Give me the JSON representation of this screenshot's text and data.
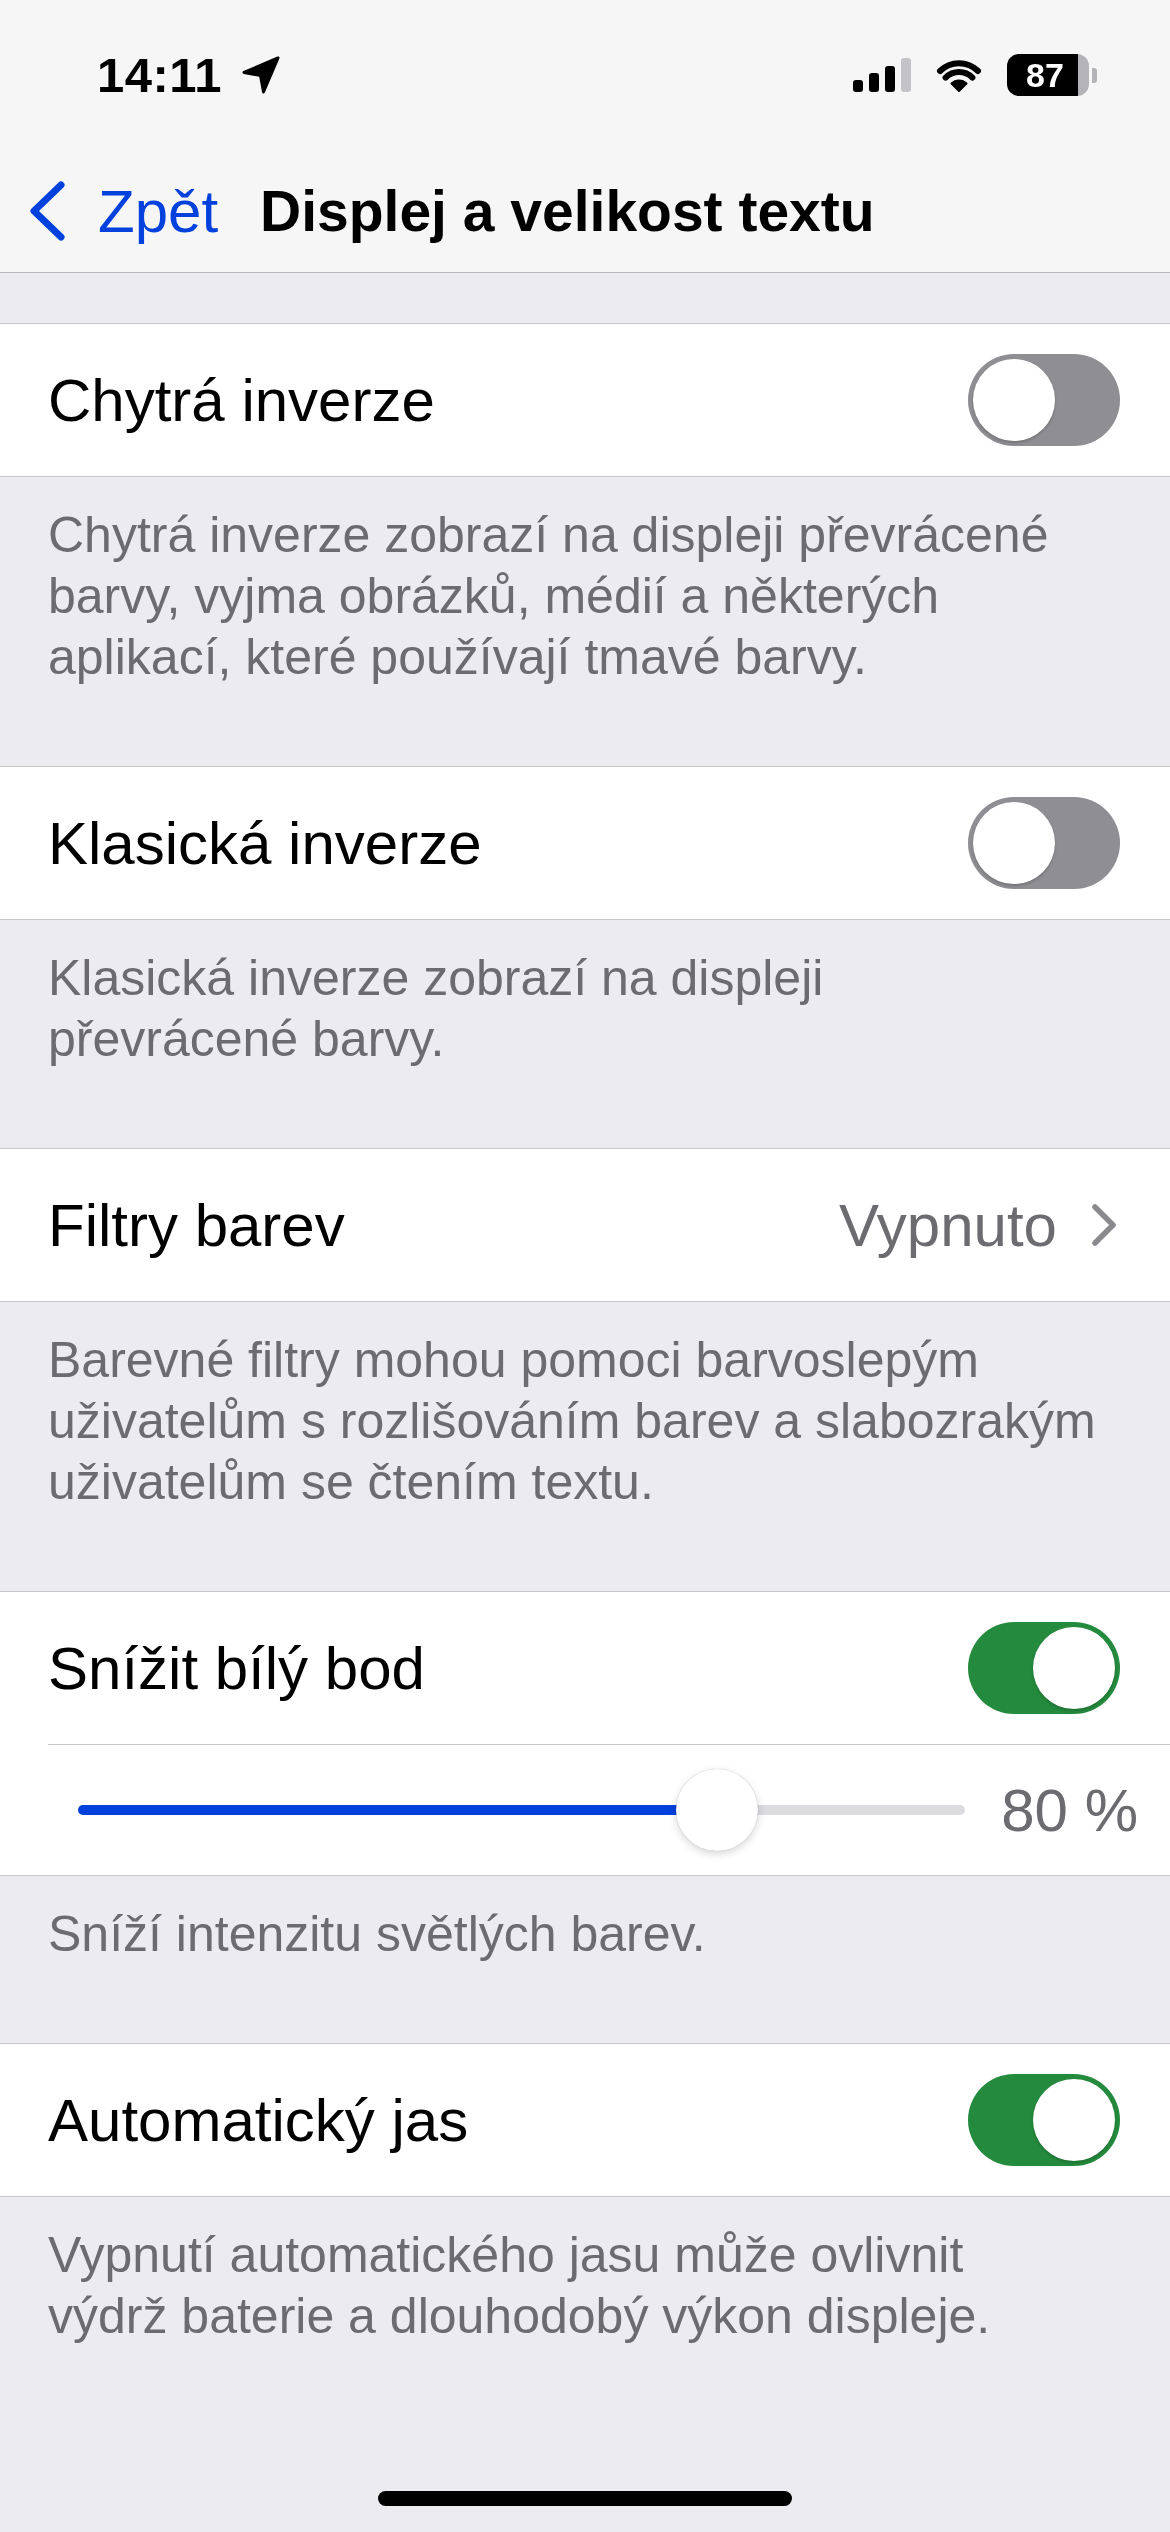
{
  "status_bar": {
    "time": "14:11",
    "battery": "87"
  },
  "nav": {
    "back": "Zpět",
    "title": "Displej a velikost textu"
  },
  "sections": [
    {
      "rows": [
        {
          "kind": "toggle",
          "label": "Chytrá inverze",
          "on": false
        }
      ],
      "footer": "Chytrá inverze zobrazí na displeji převrácené\nbarvy, vyjma obrázků, médií a některých\naplikací, které používají tmavé barvy."
    },
    {
      "rows": [
        {
          "kind": "toggle",
          "label": "Klasická inverze",
          "on": false
        }
      ],
      "footer": "Klasická inverze zobrazí na displeji\npřevrácené barvy."
    },
    {
      "rows": [
        {
          "kind": "link",
          "label": "Filtry barev",
          "value": "Vypnuto"
        }
      ],
      "footer": "Barevné filtry mohou pomoci barvoslepým\nuživatelům s rozlišováním barev a slabozrakým\nuživatelům se čtením textu."
    },
    {
      "rows": [
        {
          "kind": "toggle",
          "label": "Snížit bílý bod",
          "on": true
        },
        {
          "kind": "slider",
          "level": 0.72,
          "reading": "80 %"
        }
      ],
      "footer": "Sníží intenzitu světlých barev."
    },
    {
      "rows": [
        {
          "kind": "toggle",
          "label": "Automatický jas",
          "on": true
        }
      ],
      "footer": "Vypnutí automatického jasu může ovlivnit\nvýdrž baterie a dlouhodobý výkon displeje."
    }
  ]
}
